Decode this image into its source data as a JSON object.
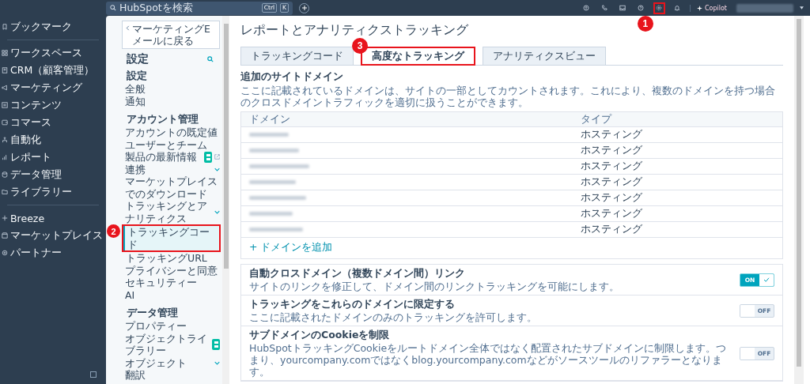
{
  "topbar": {
    "search_placeholder": "HubSpotを検索",
    "shortcut_keys": [
      "Ctrl",
      "K"
    ],
    "copilot": "Copilot",
    "icons": [
      {
        "kind": "upgrade"
      },
      {
        "kind": "phone"
      },
      {
        "kind": "inbox"
      },
      {
        "kind": "help"
      },
      {
        "kind": "settings",
        "marker": "1"
      },
      {
        "kind": "bell"
      }
    ]
  },
  "nav": {
    "items": [
      {
        "label": "ブックマーク"
      },
      {
        "label": "ワークスペース"
      },
      {
        "label": "CRM（顧客管理）"
      },
      {
        "label": "マーケティング"
      },
      {
        "label": "コンテンツ"
      },
      {
        "label": "コマース"
      },
      {
        "label": "自動化"
      },
      {
        "label": "レポート"
      },
      {
        "label": "データ管理"
      },
      {
        "label": "ライブラリー"
      },
      {
        "label": "Breeze"
      },
      {
        "label": "マーケットプレイス"
      },
      {
        "label": "パートナー"
      }
    ]
  },
  "settings_sidebar": {
    "back": "マーケティングEメールに戻る",
    "title": "設定",
    "sections": [
      {
        "title": "設定",
        "items": [
          {
            "label": "全般",
            "selected": false
          },
          {
            "label": "通知",
            "selected": false
          }
        ]
      },
      {
        "title": "アカウント管理",
        "items": [
          {
            "label": "アカウントの既定値",
            "selected": false
          },
          {
            "label": "ユーザーとチーム",
            "selected": false
          },
          {
            "label": "製品の最新情報",
            "selected": false,
            "badge": true,
            "external": true
          },
          {
            "label": "連携",
            "selected": false,
            "chevron": true
          },
          {
            "label": "マーケットプレイスでのダウンロード",
            "selected": false
          },
          {
            "label": "トラッキングとアナリティクス",
            "selected": false,
            "chevron": true,
            "children": [
              {
                "label": "トラッキングコード",
                "selected": true,
                "marker": "2"
              },
              {
                "label": "トラッキングURL",
                "selected": false
              }
            ]
          },
          {
            "label": "プライバシーと同意",
            "selected": false
          },
          {
            "label": "セキュリティー",
            "selected": false
          },
          {
            "label": "AI",
            "selected": false
          }
        ]
      },
      {
        "title": "データ管理",
        "items": [
          {
            "label": "プロパティー",
            "selected": false
          },
          {
            "label": "オブジェクトライブラリー",
            "selected": false,
            "badge": true
          },
          {
            "label": "オブジェクト",
            "selected": false,
            "chevron": true
          },
          {
            "label": "翻訳",
            "selected": false
          }
        ]
      }
    ]
  },
  "main": {
    "title": "レポートとアナリティクストラッキング",
    "tabs": [
      {
        "label": "トラッキングコード",
        "selected": false
      },
      {
        "label": "高度なトラッキング",
        "selected": true,
        "marker": "3"
      },
      {
        "label": "アナリティクスビュー",
        "selected": false
      }
    ],
    "domains": {
      "heading": "追加のサイトドメイン",
      "description": "ここに記載されているドメインは、サイトの一部としてカウントされます。これにより、複数のドメインを持つ場合のクロスドメイントラフィックを適切に扱うことができます。",
      "columns": [
        "ドメイン",
        "タイプ"
      ],
      "rows": [
        {
          "type": "ホスティング"
        },
        {
          "type": "ホスティング"
        },
        {
          "type": "ホスティング"
        },
        {
          "type": "ホスティング"
        },
        {
          "type": "ホスティング"
        },
        {
          "type": "ホスティング"
        },
        {
          "type": "ホスティング"
        }
      ],
      "add_link": "+ ドメインを追加"
    },
    "settings": [
      {
        "title": "自動クロスドメイン（複数ドメイン間）リンク",
        "description": "サイトのリンクを修正して、ドメイン間のリンクトラッキングを可能にします。",
        "on": true,
        "label": "ON"
      },
      {
        "title": "トラッキングをこれらのドメインに限定する",
        "description": "ここに記載されたドメインのみのトラッキングを許可します。",
        "on": false,
        "label": "OFF"
      },
      {
        "title": "サブドメインのCookieを制限",
        "description": "HubSpotトラッキングCookieをルートドメイン全体ではなく配置されたサブドメインに制限します。つまり、yourcompany.comではなくblog.yourcompany.comなどがソースツールのリファラーとなります。",
        "on": false,
        "label": "OFF"
      }
    ]
  }
}
